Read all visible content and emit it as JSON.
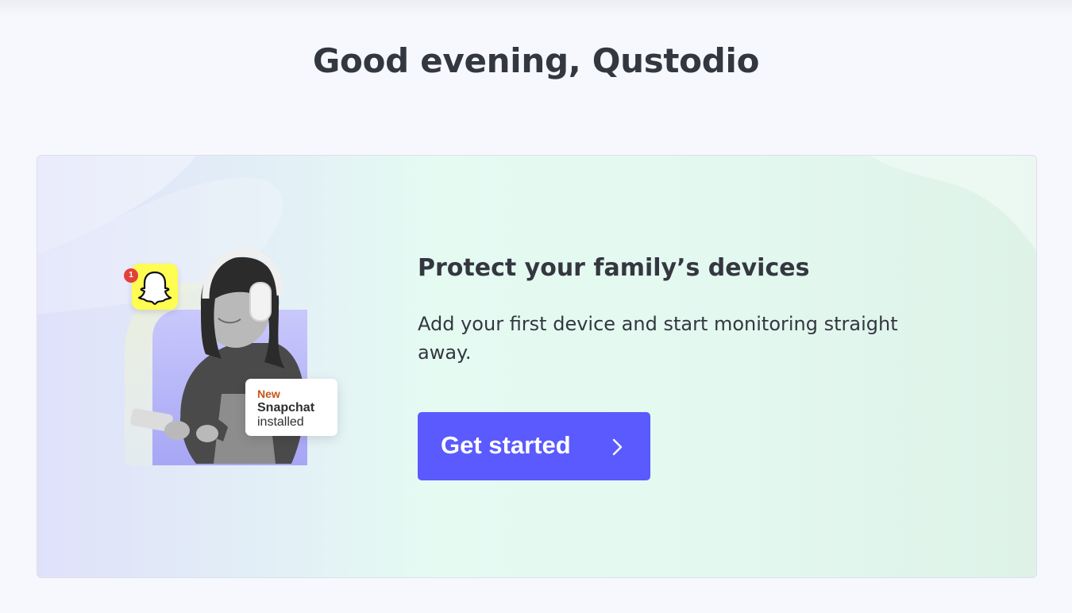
{
  "header": {
    "greeting": "Good evening, Qustodio"
  },
  "card": {
    "title": "Protect your family’s devices",
    "description": "Add your first device and start monitoring straight away.",
    "cta_label": "Get started",
    "cta_icon": "chevron-right-icon"
  },
  "illustration": {
    "app_icon": "snapchat-ghost-icon",
    "notification_count": "1",
    "toast": {
      "tag": "New",
      "app": "Snapchat",
      "status": "installed"
    }
  },
  "colors": {
    "page_background": "#f7f8fd",
    "primary_button": "#5a5aff",
    "snapchat_yellow": "#fffc52",
    "notification_red": "#e0423b",
    "toast_tag": "#c9531b"
  }
}
